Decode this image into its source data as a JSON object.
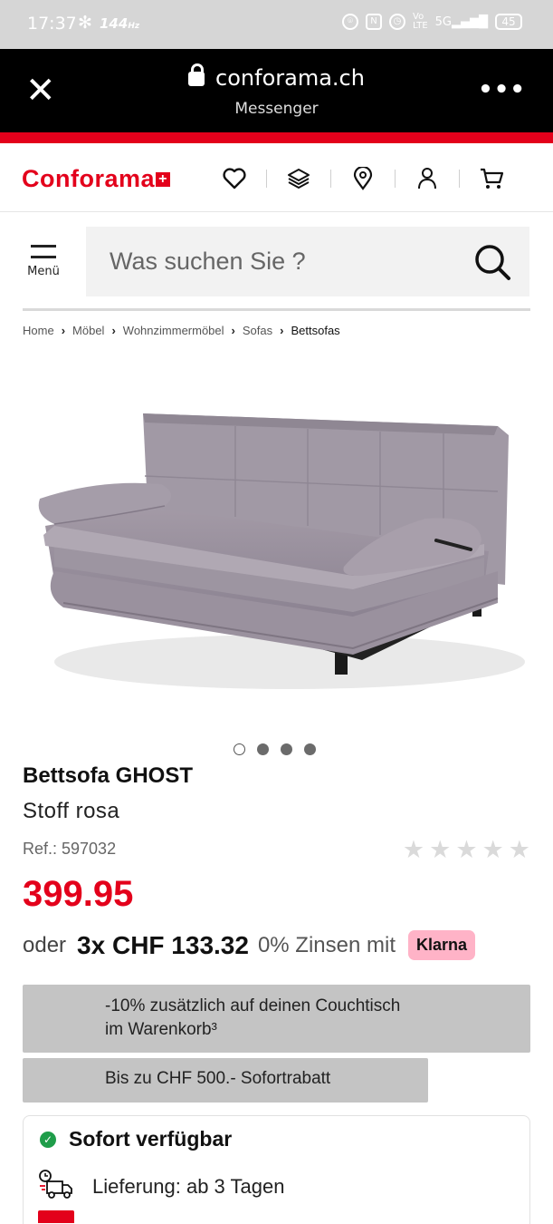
{
  "status_bar": {
    "time": "17:37",
    "refresh_rate": "144",
    "battery": "45",
    "icons": [
      "fan-icon",
      "nfc-icon",
      "alarm-icon",
      "volte-icon",
      "signal-5g-icon",
      "battery-icon"
    ]
  },
  "browser": {
    "domain": "conforama.ch",
    "subtitle": "Messenger",
    "close_icon": "close-icon",
    "more_icon": "more-icon"
  },
  "colors": {
    "brand_red": "#e3001b",
    "klarna_pink": "#ffb3c7",
    "available_green": "#1f9d4a",
    "promo_gray": "#c4c4c4"
  },
  "header": {
    "logo_text": "Conforama",
    "icons": [
      "heart-icon",
      "layers-icon",
      "location-pin-icon",
      "user-icon",
      "cart-icon"
    ]
  },
  "search": {
    "menu_label": "Menü",
    "placeholder": "Was suchen Sie ?"
  },
  "breadcrumb": [
    "Home",
    "Möbel",
    "Wohnzimmermöbel",
    "Sofas",
    "Bettsofas"
  ],
  "gallery": {
    "dot_count": 4,
    "active_index": 0
  },
  "product": {
    "title": "Bettsofa GHOST",
    "subtitle": "Stoff rosa",
    "ref": "Ref.: 597032",
    "rating_stars": 5,
    "rating_filled": 0,
    "price": "399.95"
  },
  "financing": {
    "prefix": "oder",
    "amount": "3x CHF 133.32",
    "suffix": "0% Zinsen mit",
    "provider": "Klarna"
  },
  "promos": {
    "line1a": "-10% zusätzlich auf deinen Couchtisch",
    "line1b": "im Warenkorb³",
    "line2": "Bis zu CHF 500.- Sofortrabatt"
  },
  "availability": {
    "status": "Sofort verfügbar",
    "delivery": "Lieferung: ab 3 Tagen"
  }
}
